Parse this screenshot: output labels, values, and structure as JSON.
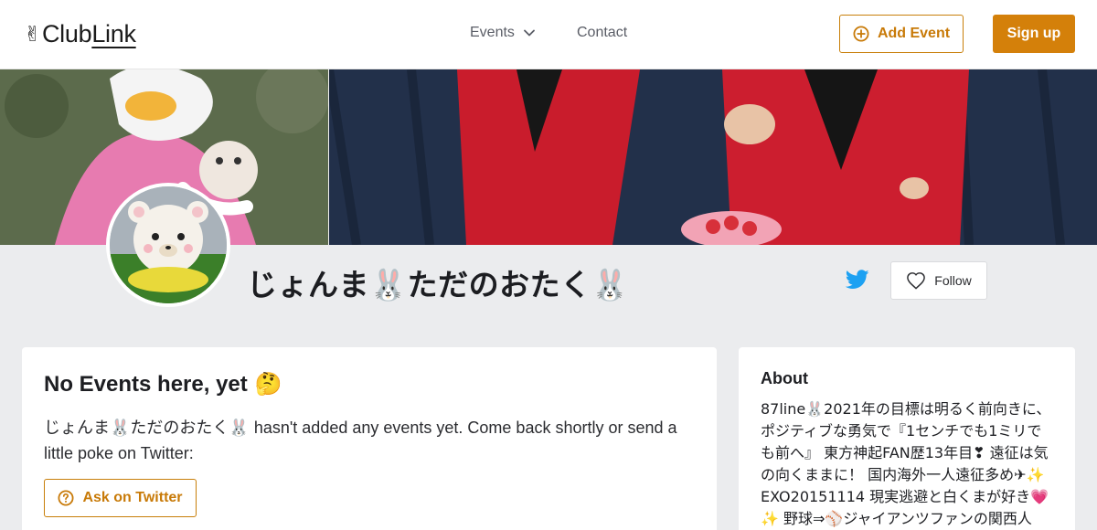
{
  "header": {
    "logo_emoji": "✌",
    "logo_club": "Club",
    "logo_link": "Link",
    "nav_events": "Events",
    "nav_contact": "Contact",
    "add_event": "Add Event",
    "sign_up": "Sign up"
  },
  "profile": {
    "name": "じょんま🐰ただのおたく🐰",
    "follow": "Follow"
  },
  "events_card": {
    "title": "No Events here, yet",
    "title_emoji": "🤔",
    "body": "じょんま🐰ただのおたく🐰 hasn't added any events yet. Come back shortly or send a little poke on Twitter:",
    "ask_button": "Ask on Twitter"
  },
  "about_card": {
    "title": "About",
    "text": "87line🐰2021年の目標は明るく前向きに、ポジティブな勇気で『1センチでも1ミリでも前へ』 東方神起FAN歴13年目❣ 遠征は気の向くままに！ 国内海外一人遠征多め✈✨ EXO20151114 現実逃避と白くまが好き💗✨ 野球⇒⚾ジャイアンツファンの関西人"
  },
  "colors": {
    "accent": "#d4800a",
    "twitter": "#1da1f2",
    "page_bg": "#ebecee"
  },
  "icons": {
    "add_event": "plus-circle-icon",
    "events_dropdown": "chevron-down-icon",
    "twitter": "twitter-icon",
    "follow": "heart-icon",
    "ask": "question-circle-icon"
  }
}
